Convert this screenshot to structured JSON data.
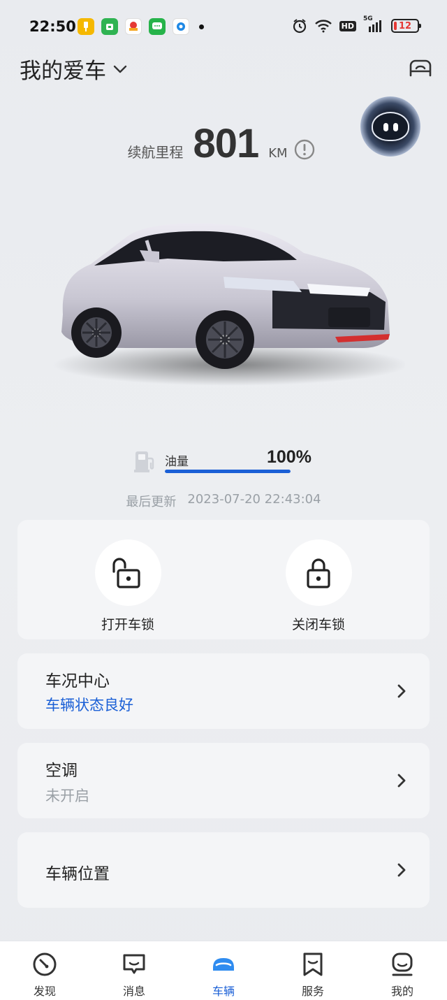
{
  "status_bar": {
    "time": "22:50",
    "battery_level": "12",
    "hd_label": "HD",
    "network": "5G"
  },
  "header": {
    "title": "我的爱车"
  },
  "range": {
    "label": "续航里程",
    "value": "801",
    "unit": "KM"
  },
  "fuel": {
    "label": "油量",
    "value": "100%",
    "level_fraction": 1.0
  },
  "last_update": {
    "label": "最后更新",
    "timestamp": "2023-07-20 22:43:04"
  },
  "lock_controls": {
    "unlock_label": "打开车锁",
    "lock_label": "关闭车锁"
  },
  "cards": {
    "status_center": {
      "title": "车况中心",
      "subtitle": "车辆状态良好"
    },
    "air_conditioning": {
      "title": "空调",
      "subtitle": "未开启"
    },
    "vehicle_location": {
      "title": "车辆位置"
    }
  },
  "bottom_nav": {
    "items": [
      {
        "label": "发现",
        "icon": "discover-icon"
      },
      {
        "label": "消息",
        "icon": "message-icon"
      },
      {
        "label": "车辆",
        "icon": "car-icon"
      },
      {
        "label": "服务",
        "icon": "service-icon"
      },
      {
        "label": "我的",
        "icon": "profile-icon"
      }
    ],
    "active_index": 2
  },
  "colors": {
    "accent": "#1a5fd6",
    "subtitle_ok": "#1a5fd6",
    "subtitle_muted": "#9aa0a6"
  }
}
